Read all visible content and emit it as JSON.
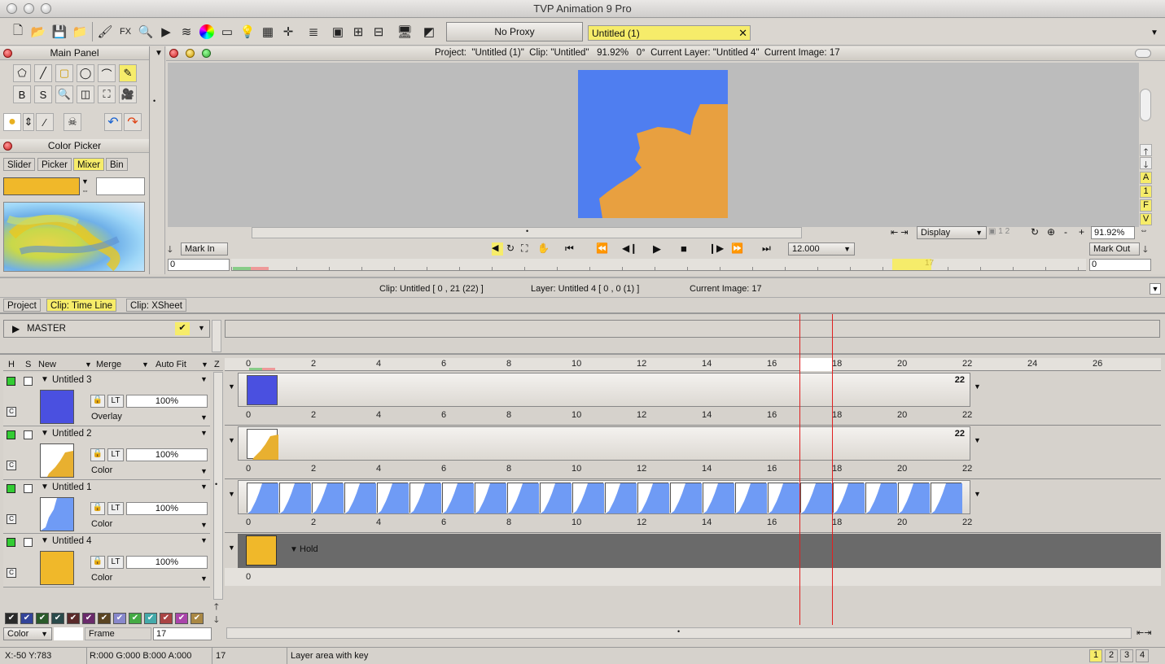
{
  "app": {
    "title": "TVP Animation 9 Pro"
  },
  "toolbar": {
    "proxy": "No Proxy",
    "doc_tab": "Untitled (1)",
    "fx": "FX"
  },
  "main_panel": {
    "title": "Main Panel"
  },
  "color_picker": {
    "title": "Color Picker",
    "tabs": [
      "Slider",
      "Picker",
      "Mixer",
      "Bin"
    ],
    "active_tab": "Mixer",
    "primary_color": "#f0b82a",
    "secondary_color": "#ffffff"
  },
  "viewer": {
    "info": "Project:  \"Untitled (1)\"  Clip: \"Untitled\"   91.92%   0°  Current Layer: \"Untitled 4\"  Current Image: 17",
    "display": "Display",
    "zoom": "91.92%",
    "mark_in": "Mark In",
    "mark_out": "Mark Out",
    "fps": "12.000",
    "in_value": "0",
    "out_value": "0",
    "side_buttons": [
      "A",
      "1",
      "F",
      "V"
    ],
    "playhead_label": "17"
  },
  "clip_info": {
    "clip": "Clip: Untitled [ 0 , 21  (22) ]",
    "layer": "Layer: Untitled 4 [ 0 , 0  (1) ]",
    "image": "Current Image: 17"
  },
  "tabs": [
    "Project",
    "Clip: Time Line",
    "Clip: XSheet"
  ],
  "active_tab": "Clip: Time Line",
  "master": {
    "label": "MASTER"
  },
  "columns": {
    "h": "H",
    "s": "S",
    "new": "New",
    "merge": "Merge",
    "autofit": "Auto Fit",
    "z": "Z"
  },
  "ruler": [
    "0",
    "2",
    "4",
    "6",
    "8",
    "10",
    "12",
    "14",
    "16",
    "18",
    "20",
    "22",
    "24",
    "26"
  ],
  "track_ruler": [
    "0",
    "2",
    "4",
    "6",
    "8",
    "10",
    "12",
    "14",
    "16",
    "18",
    "20",
    "22"
  ],
  "layers": [
    {
      "name": "Untitled 3",
      "opacity": "100%",
      "mode": "Overlay",
      "lt": "LT",
      "c": "C",
      "end": "22"
    },
    {
      "name": "Untitled 2",
      "opacity": "100%",
      "mode": "Color",
      "lt": "LT",
      "c": "C",
      "end": "22"
    },
    {
      "name": "Untitled 1",
      "opacity": "100%",
      "mode": "Color",
      "lt": "LT",
      "c": "C",
      "end": ""
    },
    {
      "name": "Untitled 4",
      "opacity": "100%",
      "mode": "Color",
      "lt": "LT",
      "c": "C",
      "end": "",
      "hold": "Hold",
      "zero": "0"
    }
  ],
  "bottom": {
    "color_label": "Color",
    "frame_label": "Frame",
    "frame_value": "17"
  },
  "swatch_colors": [
    "#2a2a2a",
    "#334499",
    "#2a5a2a",
    "#2a4a4a",
    "#5a2a2a",
    "#6a2a6a",
    "#5a4422",
    "#8888cc",
    "#44aa44",
    "#44aaaa",
    "#aa4444",
    "#aa44aa",
    "#aa8844"
  ],
  "status": {
    "coords": "X:-50  Y:783",
    "rgba": "R:000 G:000 B:000 A:000",
    "frame": "17",
    "message": "Layer area with key",
    "pages": [
      "1",
      "2",
      "3",
      "4"
    ]
  }
}
